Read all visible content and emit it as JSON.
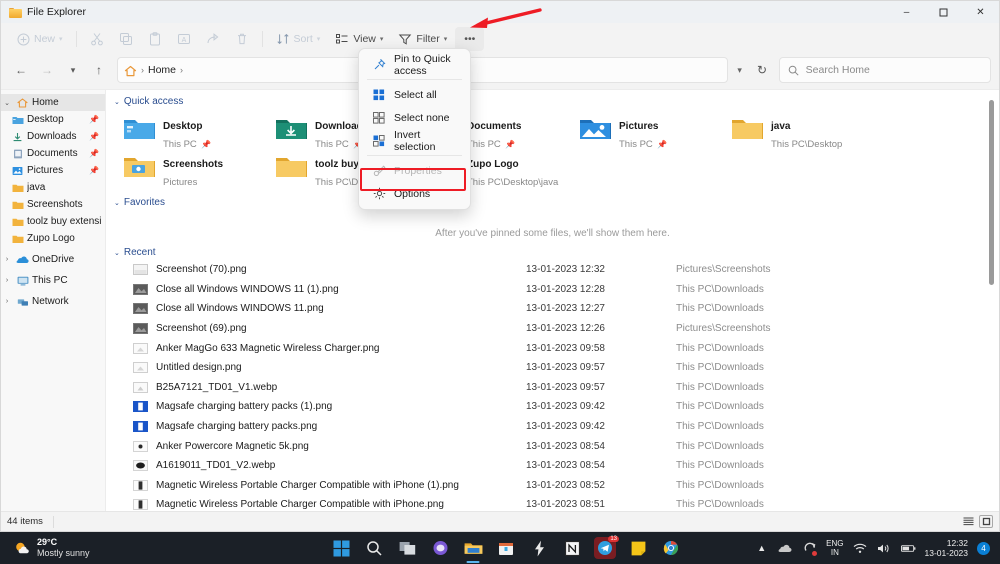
{
  "window": {
    "title": "File Explorer",
    "controls": {
      "minimize": "–",
      "maximize": "❑",
      "close": "✕"
    }
  },
  "toolbar": {
    "new_label": "New",
    "cut_icon": "cut-icon",
    "copy_icon": "copy-icon",
    "paste_icon": "paste-icon",
    "rename_icon": "rename-icon",
    "share_icon": "share-icon",
    "delete_icon": "delete-icon",
    "sort_label": "Sort",
    "view_label": "View",
    "filter_label": "Filter",
    "more_label": "•••"
  },
  "addressbar": {
    "back_icon": "back-arrow-icon",
    "forward_icon": "forward-arrow-icon",
    "recent_icon": "chevron-down-icon",
    "up_icon": "up-arrow-icon",
    "crumb_home": "Home",
    "crumb_sep": "›",
    "refresh_icon": "refresh-icon"
  },
  "search": {
    "placeholder": "Search Home",
    "icon": "search-icon"
  },
  "context_menu": {
    "items": [
      {
        "label": "Pin to Quick access",
        "icon": "pin-icon",
        "disabled": false
      },
      {
        "label": "Select all",
        "icon": "select-all-icon",
        "disabled": false
      },
      {
        "label": "Select none",
        "icon": "select-none-icon",
        "disabled": false
      },
      {
        "label": "Invert selection",
        "icon": "invert-selection-icon",
        "disabled": false
      },
      {
        "label": "Properties",
        "icon": "properties-icon",
        "disabled": true
      },
      {
        "label": "Options",
        "icon": "gear-icon",
        "disabled": false
      }
    ],
    "highlight_color": "#ee1c25",
    "highlighted_item": "Options"
  },
  "sidebar": {
    "items": [
      {
        "label": "Home",
        "icon": "home-icon",
        "expander": "⌄",
        "selected": true,
        "indent": 0,
        "pinned": false
      },
      {
        "label": "Desktop",
        "icon": "desktop-folder-icon",
        "expander": "",
        "selected": false,
        "indent": 1,
        "pinned": true
      },
      {
        "label": "Downloads",
        "icon": "downloads-icon",
        "expander": "",
        "selected": false,
        "indent": 1,
        "pinned": true
      },
      {
        "label": "Documents",
        "icon": "documents-icon",
        "expander": "",
        "selected": false,
        "indent": 1,
        "pinned": true
      },
      {
        "label": "Pictures",
        "icon": "pictures-icon",
        "expander": "",
        "selected": false,
        "indent": 1,
        "pinned": true
      },
      {
        "label": "java",
        "icon": "folder-icon",
        "expander": "",
        "selected": false,
        "indent": 1,
        "pinned": false
      },
      {
        "label": "Screenshots",
        "icon": "folder-icon",
        "expander": "",
        "selected": false,
        "indent": 1,
        "pinned": false
      },
      {
        "label": "toolz buy extension",
        "icon": "folder-icon",
        "expander": "",
        "selected": false,
        "indent": 1,
        "pinned": false
      },
      {
        "label": "Zupo Logo",
        "icon": "folder-icon",
        "expander": "",
        "selected": false,
        "indent": 1,
        "pinned": false
      },
      {
        "label": "OneDrive",
        "icon": "onedrive-icon",
        "expander": "›",
        "selected": false,
        "indent": 0,
        "pinned": false
      },
      {
        "label": "This PC",
        "icon": "this-pc-icon",
        "expander": "›",
        "selected": false,
        "indent": 0,
        "pinned": false
      },
      {
        "label": "Network",
        "icon": "network-icon",
        "expander": "›",
        "selected": false,
        "indent": 0,
        "pinned": false
      }
    ]
  },
  "main": {
    "quick_access": {
      "title": "Quick access",
      "caret": "⌄",
      "items": [
        {
          "name": "Desktop",
          "sub": "This PC",
          "icon": "desktop-folder-icon",
          "pinned": true
        },
        {
          "name": "Downloads",
          "sub": "This PC",
          "icon": "downloads-folder-icon",
          "pinned": true
        },
        {
          "name": "Documents",
          "sub": "This PC",
          "icon": "documents-folder-icon",
          "pinned": true
        },
        {
          "name": "Pictures",
          "sub": "This PC",
          "icon": "pictures-folder-icon",
          "pinned": true
        },
        {
          "name": "java",
          "sub": "This PC\\Desktop",
          "icon": "folder-icon",
          "pinned": false
        },
        {
          "name": "Screenshots",
          "sub": "Pictures",
          "icon": "screenshots-folder-icon",
          "pinned": false
        },
        {
          "name": "toolz buy extension",
          "sub": "This PC\\Deskt",
          "icon": "folder-icon",
          "pinned": false
        },
        {
          "name": "Zupo Logo",
          "sub": "This PC\\Desktop\\java",
          "icon": "folder-icon",
          "pinned": false
        }
      ]
    },
    "favorites": {
      "title": "Favorites",
      "caret": "⌄",
      "empty_text": "After you've pinned some files, we'll show them here."
    },
    "recent": {
      "title": "Recent",
      "caret": "⌄",
      "rows": [
        {
          "name": "Screenshot (70).png",
          "date": "13-01-2023 12:32",
          "location": "Pictures\\Screenshots",
          "icon": "image-thumb-light-icon"
        },
        {
          "name": "Close all Windows WINDOWS 11 (1).png",
          "date": "13-01-2023 12:28",
          "location": "This PC\\Downloads",
          "icon": "image-thumb-dark-icon"
        },
        {
          "name": "Close all Windows WINDOWS 11.png",
          "date": "13-01-2023 12:27",
          "location": "This PC\\Downloads",
          "icon": "image-thumb-dark-icon"
        },
        {
          "name": "Screenshot (69).png",
          "date": "13-01-2023 12:26",
          "location": "Pictures\\Screenshots",
          "icon": "image-thumb-dark-icon"
        },
        {
          "name": "Anker MagGo 633 Magnetic Wireless Charger.png",
          "date": "13-01-2023 09:58",
          "location": "This PC\\Downloads",
          "icon": "image-thumb-light-icon"
        },
        {
          "name": "Untitled design.png",
          "date": "13-01-2023 09:57",
          "location": "This PC\\Downloads",
          "icon": "image-thumb-light-icon"
        },
        {
          "name": "B25A7121_TD01_V1.webp",
          "date": "13-01-2023 09:57",
          "location": "This PC\\Downloads",
          "icon": "image-thumb-light-icon"
        },
        {
          "name": "Magsafe charging battery packs (1).png",
          "date": "13-01-2023 09:42",
          "location": "This PC\\Downloads",
          "icon": "image-thumb-blue-icon"
        },
        {
          "name": "Magsafe charging battery packs.png",
          "date": "13-01-2023 09:42",
          "location": "This PC\\Downloads",
          "icon": "image-thumb-blue-icon"
        },
        {
          "name": "Anker Powercore Magnetic 5k.png",
          "date": "13-01-2023 08:54",
          "location": "This PC\\Downloads",
          "icon": "image-thumb-light-icon"
        },
        {
          "name": "A1619011_TD01_V2.webp",
          "date": "13-01-2023 08:54",
          "location": "This PC\\Downloads",
          "icon": "image-thumb-black-icon"
        },
        {
          "name": "Magnetic Wireless Portable Charger Compatible with iPhone (1).png",
          "date": "13-01-2023 08:52",
          "location": "This PC\\Downloads",
          "icon": "image-thumb-light-icon"
        },
        {
          "name": "Magnetic Wireless Portable Charger Compatible with iPhone.png",
          "date": "13-01-2023 08:51",
          "location": "This PC\\Downloads",
          "icon": "image-thumb-light-icon"
        }
      ]
    }
  },
  "statusbar": {
    "item_count": "44 items",
    "list_view_icon": "list-view-icon",
    "details_view_icon": "details-view-icon"
  },
  "taskbar": {
    "weather": {
      "temperature": "29°C",
      "description": "Mostly sunny",
      "icon": "partly-sunny-icon"
    },
    "apps": [
      {
        "name": "start-button",
        "icon": "windows-logo-icon",
        "running": false
      },
      {
        "name": "search-button",
        "icon": "search-icon",
        "running": false
      },
      {
        "name": "task-view-button",
        "icon": "task-view-icon",
        "running": false
      },
      {
        "name": "chat-button",
        "icon": "chat-icon",
        "running": false
      },
      {
        "name": "file-explorer-button",
        "icon": "file-explorer-icon",
        "running": true
      },
      {
        "name": "microsoft-store-button",
        "icon": "store-icon",
        "running": false
      },
      {
        "name": "lightning-app-button",
        "icon": "lightning-icon",
        "running": false
      },
      {
        "name": "notion-button",
        "icon": "notion-icon",
        "running": false
      },
      {
        "name": "telegram-button",
        "icon": "telegram-icon",
        "running": false,
        "badge": "13"
      },
      {
        "name": "sticky-notes-button",
        "icon": "sticky-note-icon",
        "running": false
      },
      {
        "name": "chrome-button",
        "icon": "chrome-icon",
        "running": false
      }
    ],
    "tray": {
      "show_hidden_icon": "chevron-up-icon",
      "onedrive_icon": "onedrive-tray-icon",
      "update_icon": "update-needed-icon",
      "language_line1": "ENG",
      "language_line2": "IN",
      "wifi_icon": "wifi-icon",
      "volume_icon": "volume-icon",
      "battery_icon": "battery-icon",
      "time": "12:32",
      "date": "13-01-2023",
      "notification_badge": "4"
    }
  }
}
